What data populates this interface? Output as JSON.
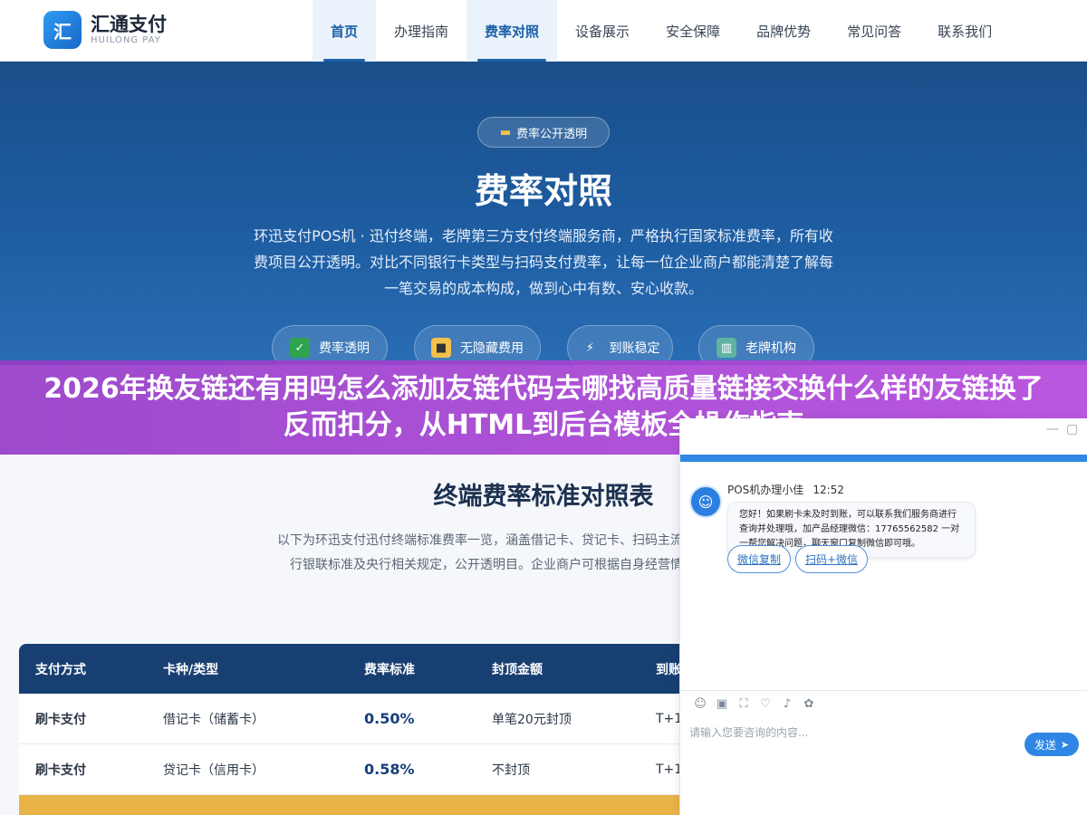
{
  "header": {
    "logo_mark": "汇",
    "logo_name": "汇通支付",
    "logo_sub": "HUILONG PAY",
    "nav": [
      "首页",
      "办理指南",
      "费率对照",
      "设备展示",
      "安全保障",
      "品牌优势",
      "常见问答",
      "联系我们"
    ]
  },
  "hero": {
    "tag": "费率公开透明",
    "title": "费率对照",
    "desc": "环迅支付POS机 · 迅付终端，老牌第三方支付终端服务商，严格执行国家标准费率，所有收费项目公开透明。对比不同银行卡类型与扫码支付费率，让每一位企业商户都能清楚了解每一笔交易的成本构成，做到心中有数、安心收款。",
    "badges": [
      "费率透明",
      "无隐藏费用",
      "到账稳定",
      "老牌机构"
    ]
  },
  "banner": {
    "text": "2026年换友链还有用吗怎么添加友链代码去哪找高质量链接交换什么样的友链换了反而扣分，从HTML到后台模板全操作指南"
  },
  "section": {
    "title": "终端费率标准对照表",
    "desc": "以下为环迅支付迅付终端标准费率一览，涵盖借记卡、贷记卡、扫码主流支付方式。费率严格执行银联标准及央行相关规定，公开透明目。企业商户可根据自身经营情况选择最适合的收款"
  },
  "table": {
    "headers": [
      "支付方式",
      "卡种/类型",
      "费率标准",
      "封顶金额",
      "到账"
    ],
    "rows": [
      [
        "刷卡支付",
        "借记卡（储蓄卡）",
        "0.50%",
        "单笔20元封顶",
        "T+1"
      ],
      [
        "刷卡支付",
        "贷记卡（信用卡）",
        "0.58%",
        "不封顶",
        "T+1"
      ]
    ]
  },
  "chat": {
    "agent": "POS机办理小佳",
    "time": "12:52",
    "message": "您好！如果刷卡未及时到账，可以联系我们服务商进行查询并处理哦，加产品经理微信：17765562582 一对一帮您解决问题，聊天窗口复制微信即可哦。",
    "buttons": [
      "微信复制",
      "扫码+微信"
    ],
    "placeholder": "请输入您要咨询的内容...",
    "send": "发送"
  }
}
